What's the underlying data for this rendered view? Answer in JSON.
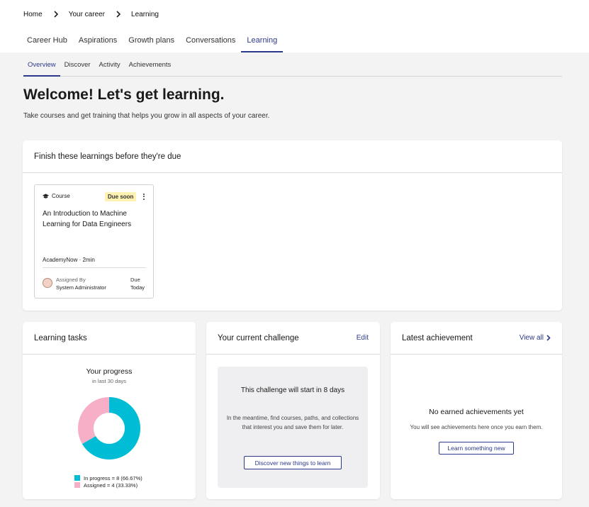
{
  "breadcrumb": [
    "Home",
    "Your career",
    "Learning"
  ],
  "main_tabs": [
    {
      "label": "Career Hub",
      "active": false
    },
    {
      "label": "Aspirations",
      "active": false
    },
    {
      "label": "Growth plans",
      "active": false
    },
    {
      "label": "Conversations",
      "active": false
    },
    {
      "label": "Learning",
      "active": true
    }
  ],
  "sub_tabs": [
    {
      "label": "Overview",
      "active": true
    },
    {
      "label": "Discover",
      "active": false
    },
    {
      "label": "Activity",
      "active": false
    },
    {
      "label": "Achievements",
      "active": false
    }
  ],
  "welcome": {
    "title": "Welcome! Let's get learning.",
    "subtitle": "Take courses and get training that helps you grow in all aspects of your career."
  },
  "due_section": {
    "title": "Finish these learnings before they're due",
    "course": {
      "type_label": "Course",
      "type_icon": "graduation-cap-icon",
      "badge": "Due soon",
      "title": "An Introduction to Machine Learning for Data Engineers",
      "meta": "AcademyNow · 2min",
      "assigned_label": "Assigned By",
      "assigned_value": "System Administrator",
      "due_label": "Due",
      "due_value": "Today"
    }
  },
  "tasks": {
    "title": "Learning tasks",
    "progress_title": "Your progress",
    "progress_sub": "in last 30 days",
    "legend": [
      {
        "label": "In progress = 8 (66.67%)",
        "value": 8,
        "color": "#00bcd4"
      },
      {
        "label": "Assigned = 4 (33.33%)",
        "value": 4,
        "color": "#f7afc8"
      }
    ]
  },
  "challenge": {
    "title": "Your current challenge",
    "edit_label": "Edit",
    "heading": "This challenge will start in 8 days",
    "text": "In the meantime, find courses, paths, and collections that interest you and save them for later.",
    "button": "Discover new things to learn"
  },
  "achievement": {
    "title": "Latest achievement",
    "view_all": "View all",
    "empty_title": "No earned achievements yet",
    "empty_text": "You will see achievements here once you earn them.",
    "button": "Learn something new"
  },
  "colors": {
    "accent": "#2d3a8c",
    "badge_bg": "#fdf2b2"
  }
}
